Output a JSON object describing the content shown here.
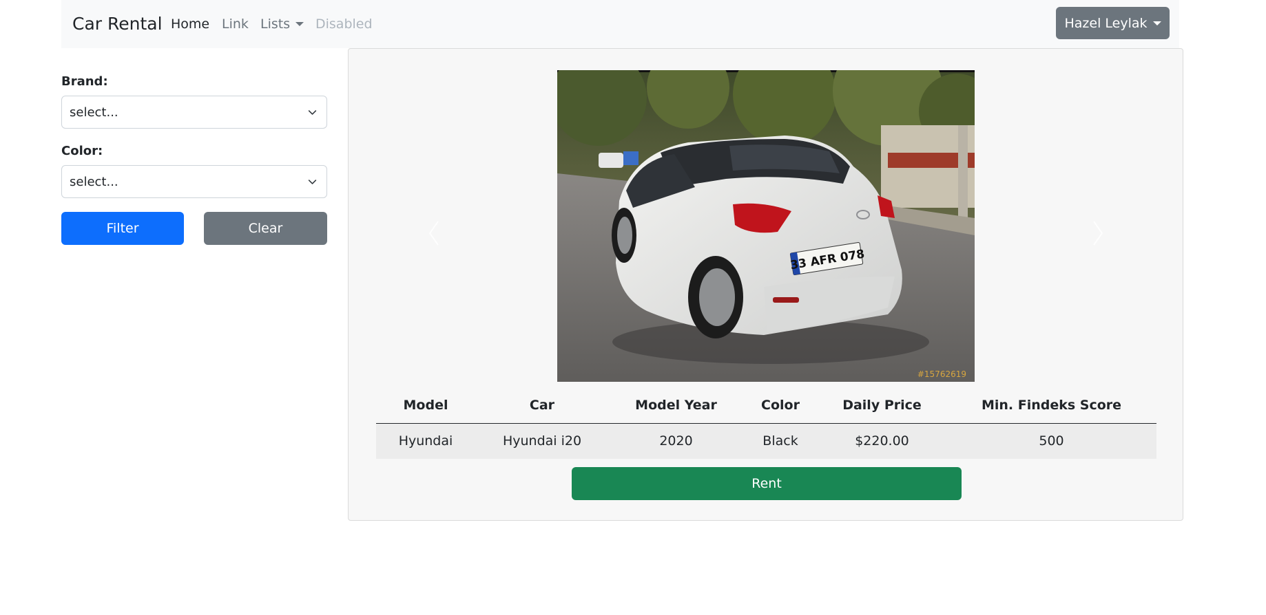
{
  "navbar": {
    "brand": "Car Rental",
    "links": [
      {
        "label": "Home"
      },
      {
        "label": "Link"
      },
      {
        "label": "Lists"
      },
      {
        "label": "Disabled"
      }
    ],
    "user_name": "Hazel Leylak"
  },
  "filters": {
    "brand_label": "Brand:",
    "brand_value": "select...",
    "color_label": "Color:",
    "color_value": "select...",
    "filter_label": "Filter",
    "clear_label": "Clear"
  },
  "carousel": {
    "plate_text": "33 AFR 078",
    "watermark": "#15762619",
    "prev_icon": "chevron-left-icon",
    "next_icon": "chevron-right-icon"
  },
  "table": {
    "headers": [
      "Model",
      "Car",
      "Model Year",
      "Color",
      "Daily Price",
      "Min. Findeks Score"
    ],
    "rows": [
      [
        "Hyundai",
        "Hyundai i20",
        "2020",
        "Black",
        "$220.00",
        "500"
      ]
    ]
  },
  "rent_label": "Rent",
  "colors": {
    "primary": "#0d6efd",
    "secondary": "#6c757d",
    "success": "#198754",
    "navbar_bg": "#f8f9fa"
  }
}
